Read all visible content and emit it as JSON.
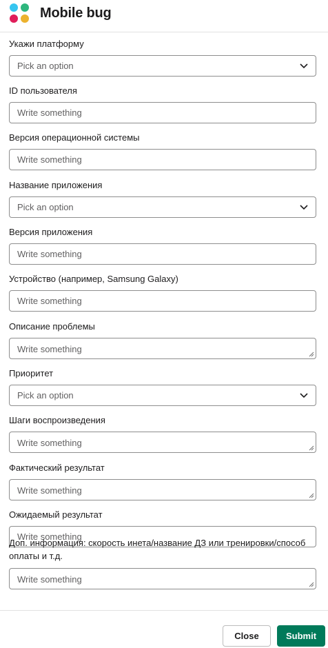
{
  "header": {
    "title": "Mobile bug",
    "logo_icon": "slack-logo-icon"
  },
  "colors": {
    "accent": "#007a5a",
    "border": "#8d8d8d",
    "placeholder": "#616061"
  },
  "fields": [
    {
      "label": "Укажи платформу",
      "type": "select",
      "placeholder": "Pick an option"
    },
    {
      "label": "ID пользователя",
      "type": "input",
      "placeholder": "Write something"
    },
    {
      "label": "Версия операционной системы",
      "type": "input",
      "placeholder": "Write something"
    },
    {
      "label": "Название приложения",
      "type": "select",
      "placeholder": "Pick an option"
    },
    {
      "label": "Версия приложения",
      "type": "input",
      "placeholder": "Write something"
    },
    {
      "label": "Устройство (например, Samsung Galaxy)",
      "type": "input",
      "placeholder": "Write something"
    },
    {
      "label": "Описание проблемы",
      "type": "textarea",
      "placeholder": "Write something"
    },
    {
      "label": "Приоритет",
      "type": "select",
      "placeholder": "Pick an option"
    },
    {
      "label": "Шаги воспроизведения",
      "type": "textarea",
      "placeholder": "Write something"
    },
    {
      "label": "Фактический результат",
      "type": "textarea",
      "placeholder": "Write something"
    },
    {
      "label": "Ожидаемый результат",
      "type": "input",
      "placeholder": "Write something"
    },
    {
      "label": "Доп. информация: скорость инета/название ДЗ или тренировки/способ",
      "label_line2": "оплаты и т.д.",
      "type": "textarea",
      "placeholder": "Write something"
    }
  ],
  "footer": {
    "close_label": "Close",
    "submit_label": "Submit"
  }
}
